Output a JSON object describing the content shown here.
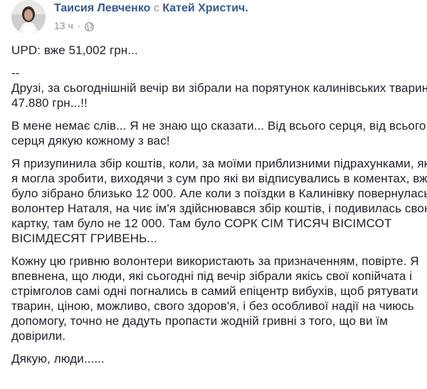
{
  "post": {
    "author": "Таисия Левченко",
    "with_word": "с",
    "tagged": "Катей Христич.",
    "time": "13 ч",
    "dot": "·",
    "globe_icon": "globe-icon",
    "paragraphs": [
      {
        "lines": [
          "UPD: вже 51,002 грн..."
        ]
      },
      {
        "lines": [
          "--",
          "Друзі, за сьогоднішній вечір ви зібрали на порятунок калинівських тварин",
          "47.880 грн...!!"
        ]
      },
      {
        "lines": [
          "В мене немає слів... Я не знаю що сказати... Від всього серця, від всього",
          "серця дякую кожному з вас!"
        ]
      },
      {
        "lines": [
          "Я призупинила збір коштів, коли, за моїми приблизними підрахунками, як",
          "я могла зробити, виходячи з сум про які ви відписувались в коментах, вже",
          "було зібрано близько 12 000. Але коли з поїздки в Калинівку повернулась",
          "волонтер Наталя, на чиє ім'я здійснювався збір коштів, і подивилась свою",
          "картку, там було не 12 000. Там було СОРК СІМ ТИСЯЧ ВІСІМСОТ",
          "ВІСІМДЕСЯТ ГРИВЕНЬ..."
        ]
      },
      {
        "lines": [
          "Кожну цю гривню волонтери використають за призначенням, повірте. Я",
          "впевнена, що люди, які сьогодні під вечір зібрали якісь свої копійчата і",
          "стрімголов самі одні погнались в самий епіцентр вибухів, щоб рятувати",
          "тварин, ціною, можливо, свого здоров'я, і без особливої надії на чиюсь",
          "допомогу, точно не дадуть пропасти жодній гривні з того, що ви їм",
          "довірили."
        ]
      },
      {
        "lines": [
          "Дякую, люди......"
        ]
      }
    ]
  }
}
